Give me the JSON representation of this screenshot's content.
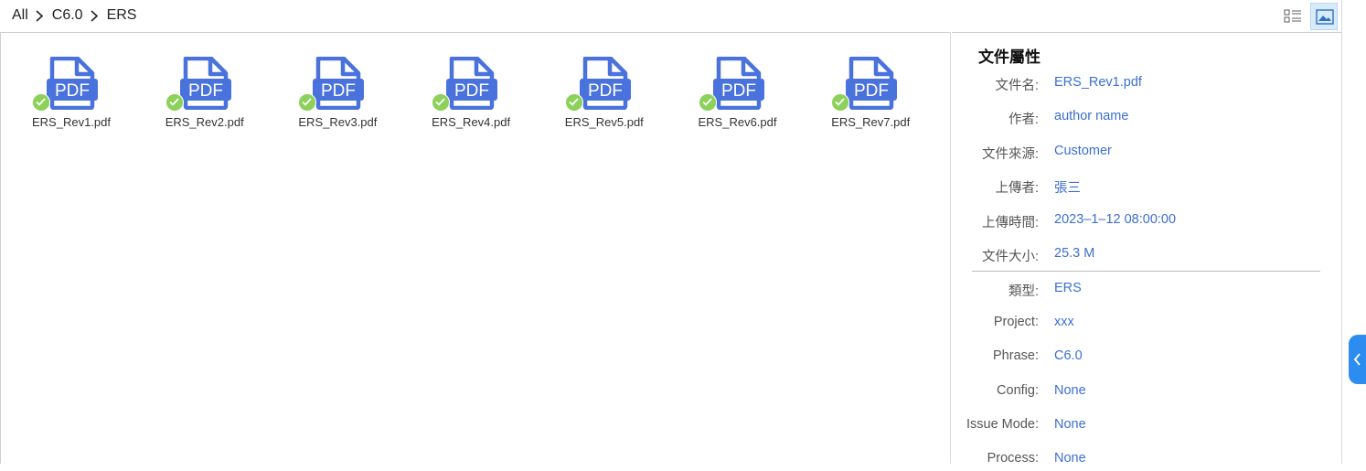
{
  "breadcrumb": {
    "items": [
      "All",
      "C6.0",
      "ERS"
    ]
  },
  "view": {
    "list_icon": "list-view-icon",
    "thumbnail_icon": "thumbnail-view-icon",
    "active": "thumbnail"
  },
  "files": [
    {
      "name": "ERS_Rev1.pdf",
      "icon_label": "PDF",
      "status": "checked"
    },
    {
      "name": "ERS_Rev2.pdf",
      "icon_label": "PDF",
      "status": "checked"
    },
    {
      "name": "ERS_Rev3.pdf",
      "icon_label": "PDF",
      "status": "checked"
    },
    {
      "name": "ERS_Rev4.pdf",
      "icon_label": "PDF",
      "status": "checked"
    },
    {
      "name": "ERS_Rev5.pdf",
      "icon_label": "PDF",
      "status": "checked"
    },
    {
      "name": "ERS_Rev6.pdf",
      "icon_label": "PDF",
      "status": "checked"
    },
    {
      "name": "ERS_Rev7.pdf",
      "icon_label": "PDF",
      "status": "checked"
    }
  ],
  "properties": {
    "title": "文件屬性",
    "rows": [
      {
        "label": "文件名:",
        "value": "ERS_Rev1.pdf"
      },
      {
        "label": "作者:",
        "value": "author name"
      },
      {
        "label": "文件來源:",
        "value": "Customer"
      },
      {
        "label": "上傳者:",
        "value": "張三"
      },
      {
        "label": "上傳時間:",
        "value": "2023–1–12 08:00:00"
      },
      {
        "label": "文件大小:",
        "value": "25.3 M"
      },
      {
        "label": "類型:",
        "value": "ERS"
      },
      {
        "label": "Project:",
        "value": "xxx"
      },
      {
        "label": "Phrase:",
        "value": "C6.0"
      },
      {
        "label": "Config:",
        "value": "None"
      },
      {
        "label": "Issue Mode:",
        "value": "None"
      },
      {
        "label": "Process:",
        "value": "None"
      }
    ]
  },
  "colors": {
    "pdf_icon": "#4a72dd",
    "check": "#8bd15a",
    "value_text": "#3c6fd1",
    "collapse_button": "#2d8cf0"
  }
}
